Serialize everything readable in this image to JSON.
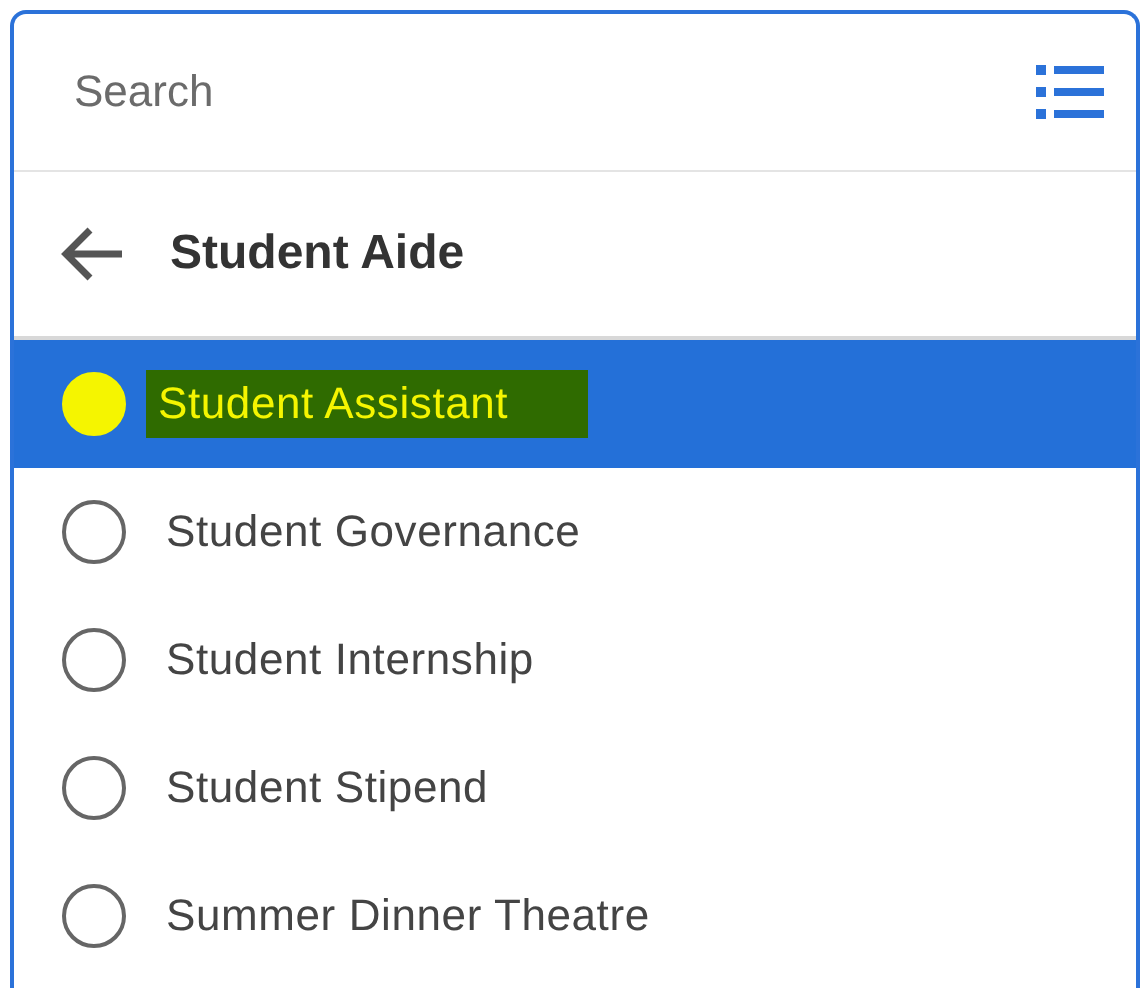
{
  "search": {
    "placeholder": "Search"
  },
  "header": {
    "title": "Student Aide"
  },
  "options": [
    {
      "label": "Student Assistant",
      "selected": true,
      "highlighted": true
    },
    {
      "label": "Student Governance",
      "selected": false,
      "highlighted": false
    },
    {
      "label": "Student Internship",
      "selected": false,
      "highlighted": false
    },
    {
      "label": "Student Stipend",
      "selected": false,
      "highlighted": false
    },
    {
      "label": "Summer Dinner Theatre",
      "selected": false,
      "highlighted": false
    }
  ]
}
